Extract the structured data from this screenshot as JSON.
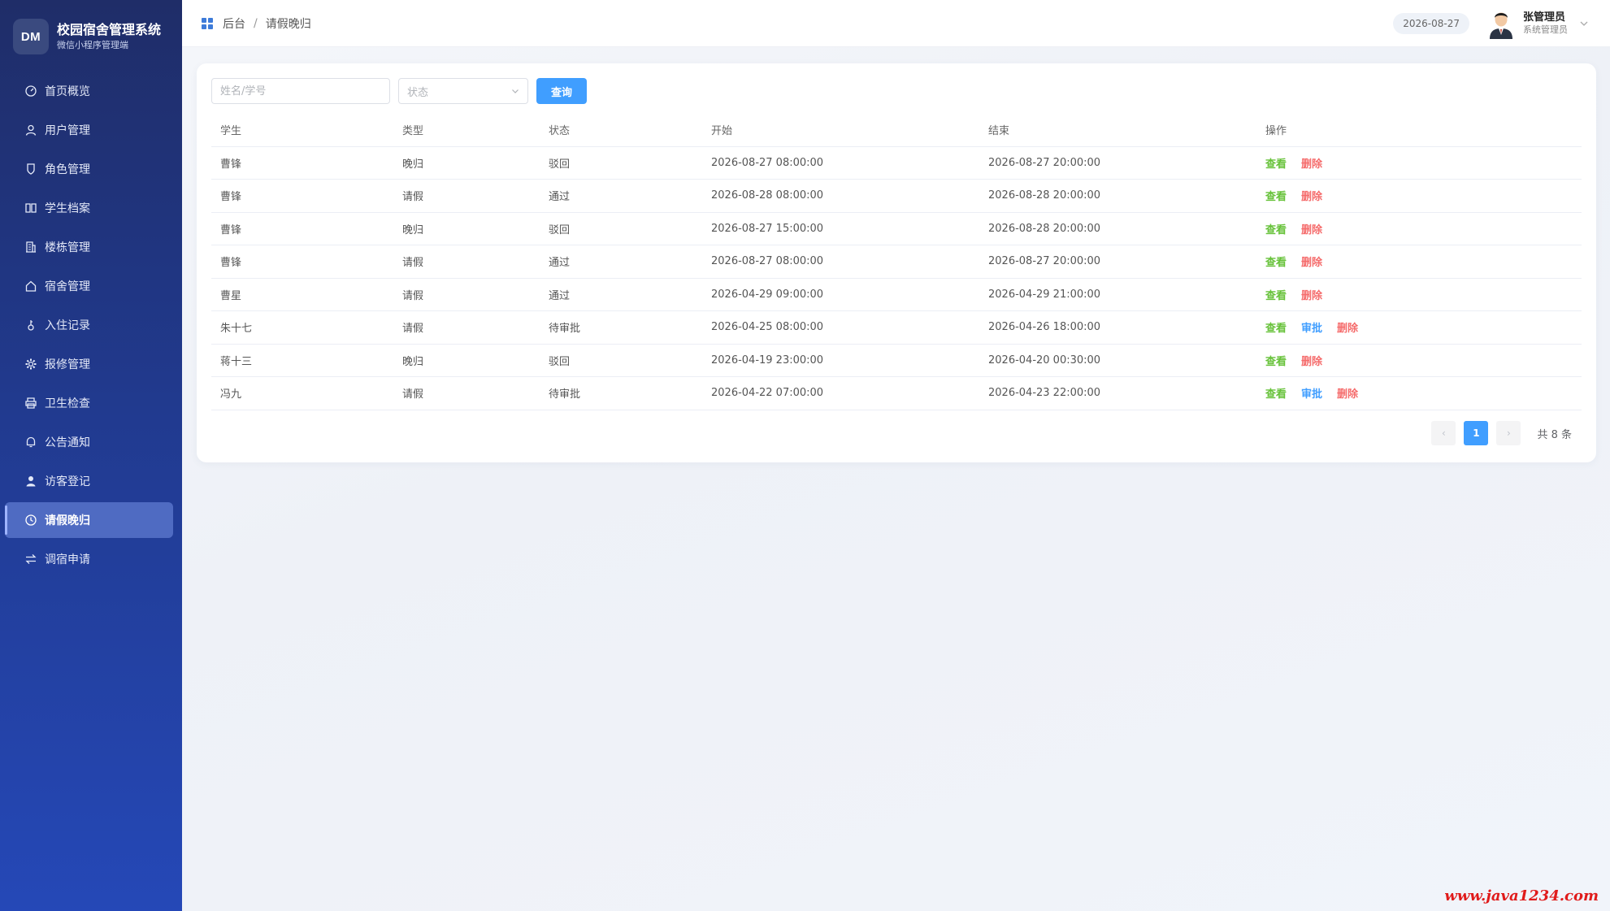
{
  "brand": {
    "logo": "DM",
    "title": "校园宿舍管理系统",
    "subtitle": "微信小程序管理端"
  },
  "sidebar": {
    "items": [
      {
        "label": "首页概览",
        "icon": "dashboard-icon"
      },
      {
        "label": "用户管理",
        "icon": "user-icon"
      },
      {
        "label": "角色管理",
        "icon": "role-icon"
      },
      {
        "label": "学生档案",
        "icon": "book-icon"
      },
      {
        "label": "楼栋管理",
        "icon": "building-icon"
      },
      {
        "label": "宿舍管理",
        "icon": "house-icon"
      },
      {
        "label": "入住记录",
        "icon": "key-icon"
      },
      {
        "label": "报修管理",
        "icon": "gear-icon"
      },
      {
        "label": "卫生检查",
        "icon": "printer-icon"
      },
      {
        "label": "公告通知",
        "icon": "bell-icon"
      },
      {
        "label": "访客登记",
        "icon": "person-icon"
      },
      {
        "label": "请假晚归",
        "icon": "clock-icon",
        "active": true
      },
      {
        "label": "调宿申请",
        "icon": "swap-icon"
      }
    ]
  },
  "header": {
    "breadcrumb": {
      "root": "后台",
      "separator": "/",
      "current": "请假晚归"
    },
    "date": "2026-08-27",
    "user": {
      "name": "张管理员",
      "role": "系统管理员"
    }
  },
  "filters": {
    "search_placeholder": "姓名/学号",
    "status_placeholder": "状态",
    "query_button": "查询"
  },
  "table": {
    "columns": [
      "学生",
      "类型",
      "状态",
      "开始",
      "结束",
      "操作"
    ],
    "rows": [
      {
        "student": "曹锋",
        "type": "晚归",
        "status": "驳回",
        "start": "2026-08-27 08:00:00",
        "end": "2026-08-27 20:00:00",
        "actions": [
          "查看",
          "删除"
        ]
      },
      {
        "student": "曹锋",
        "type": "请假",
        "status": "通过",
        "start": "2026-08-28 08:00:00",
        "end": "2026-08-28 20:00:00",
        "actions": [
          "查看",
          "删除"
        ]
      },
      {
        "student": "曹锋",
        "type": "晚归",
        "status": "驳回",
        "start": "2026-08-27 15:00:00",
        "end": "2026-08-28 20:00:00",
        "actions": [
          "查看",
          "删除"
        ]
      },
      {
        "student": "曹锋",
        "type": "请假",
        "status": "通过",
        "start": "2026-08-27 08:00:00",
        "end": "2026-08-27 20:00:00",
        "actions": [
          "查看",
          "删除"
        ]
      },
      {
        "student": "曹星",
        "type": "请假",
        "status": "通过",
        "start": "2026-04-29 09:00:00",
        "end": "2026-04-29 21:00:00",
        "actions": [
          "查看",
          "删除"
        ]
      },
      {
        "student": "朱十七",
        "type": "请假",
        "status": "待审批",
        "start": "2026-04-25 08:00:00",
        "end": "2026-04-26 18:00:00",
        "actions": [
          "查看",
          "审批",
          "删除"
        ]
      },
      {
        "student": "蒋十三",
        "type": "晚归",
        "status": "驳回",
        "start": "2026-04-19 23:00:00",
        "end": "2026-04-20 00:30:00",
        "actions": [
          "查看",
          "删除"
        ]
      },
      {
        "student": "冯九",
        "type": "请假",
        "status": "待审批",
        "start": "2026-04-22 07:00:00",
        "end": "2026-04-23 22:00:00",
        "actions": [
          "查看",
          "审批",
          "删除"
        ]
      }
    ]
  },
  "pagination": {
    "prev": "‹",
    "current_page": "1",
    "next": "›",
    "total_text": "共 8 条"
  },
  "colors": {
    "primary": "#409eff",
    "view": "#67c23a",
    "delete": "#f56c6c",
    "sidebar": "#213a8f"
  },
  "watermark": "www.java1234.com"
}
